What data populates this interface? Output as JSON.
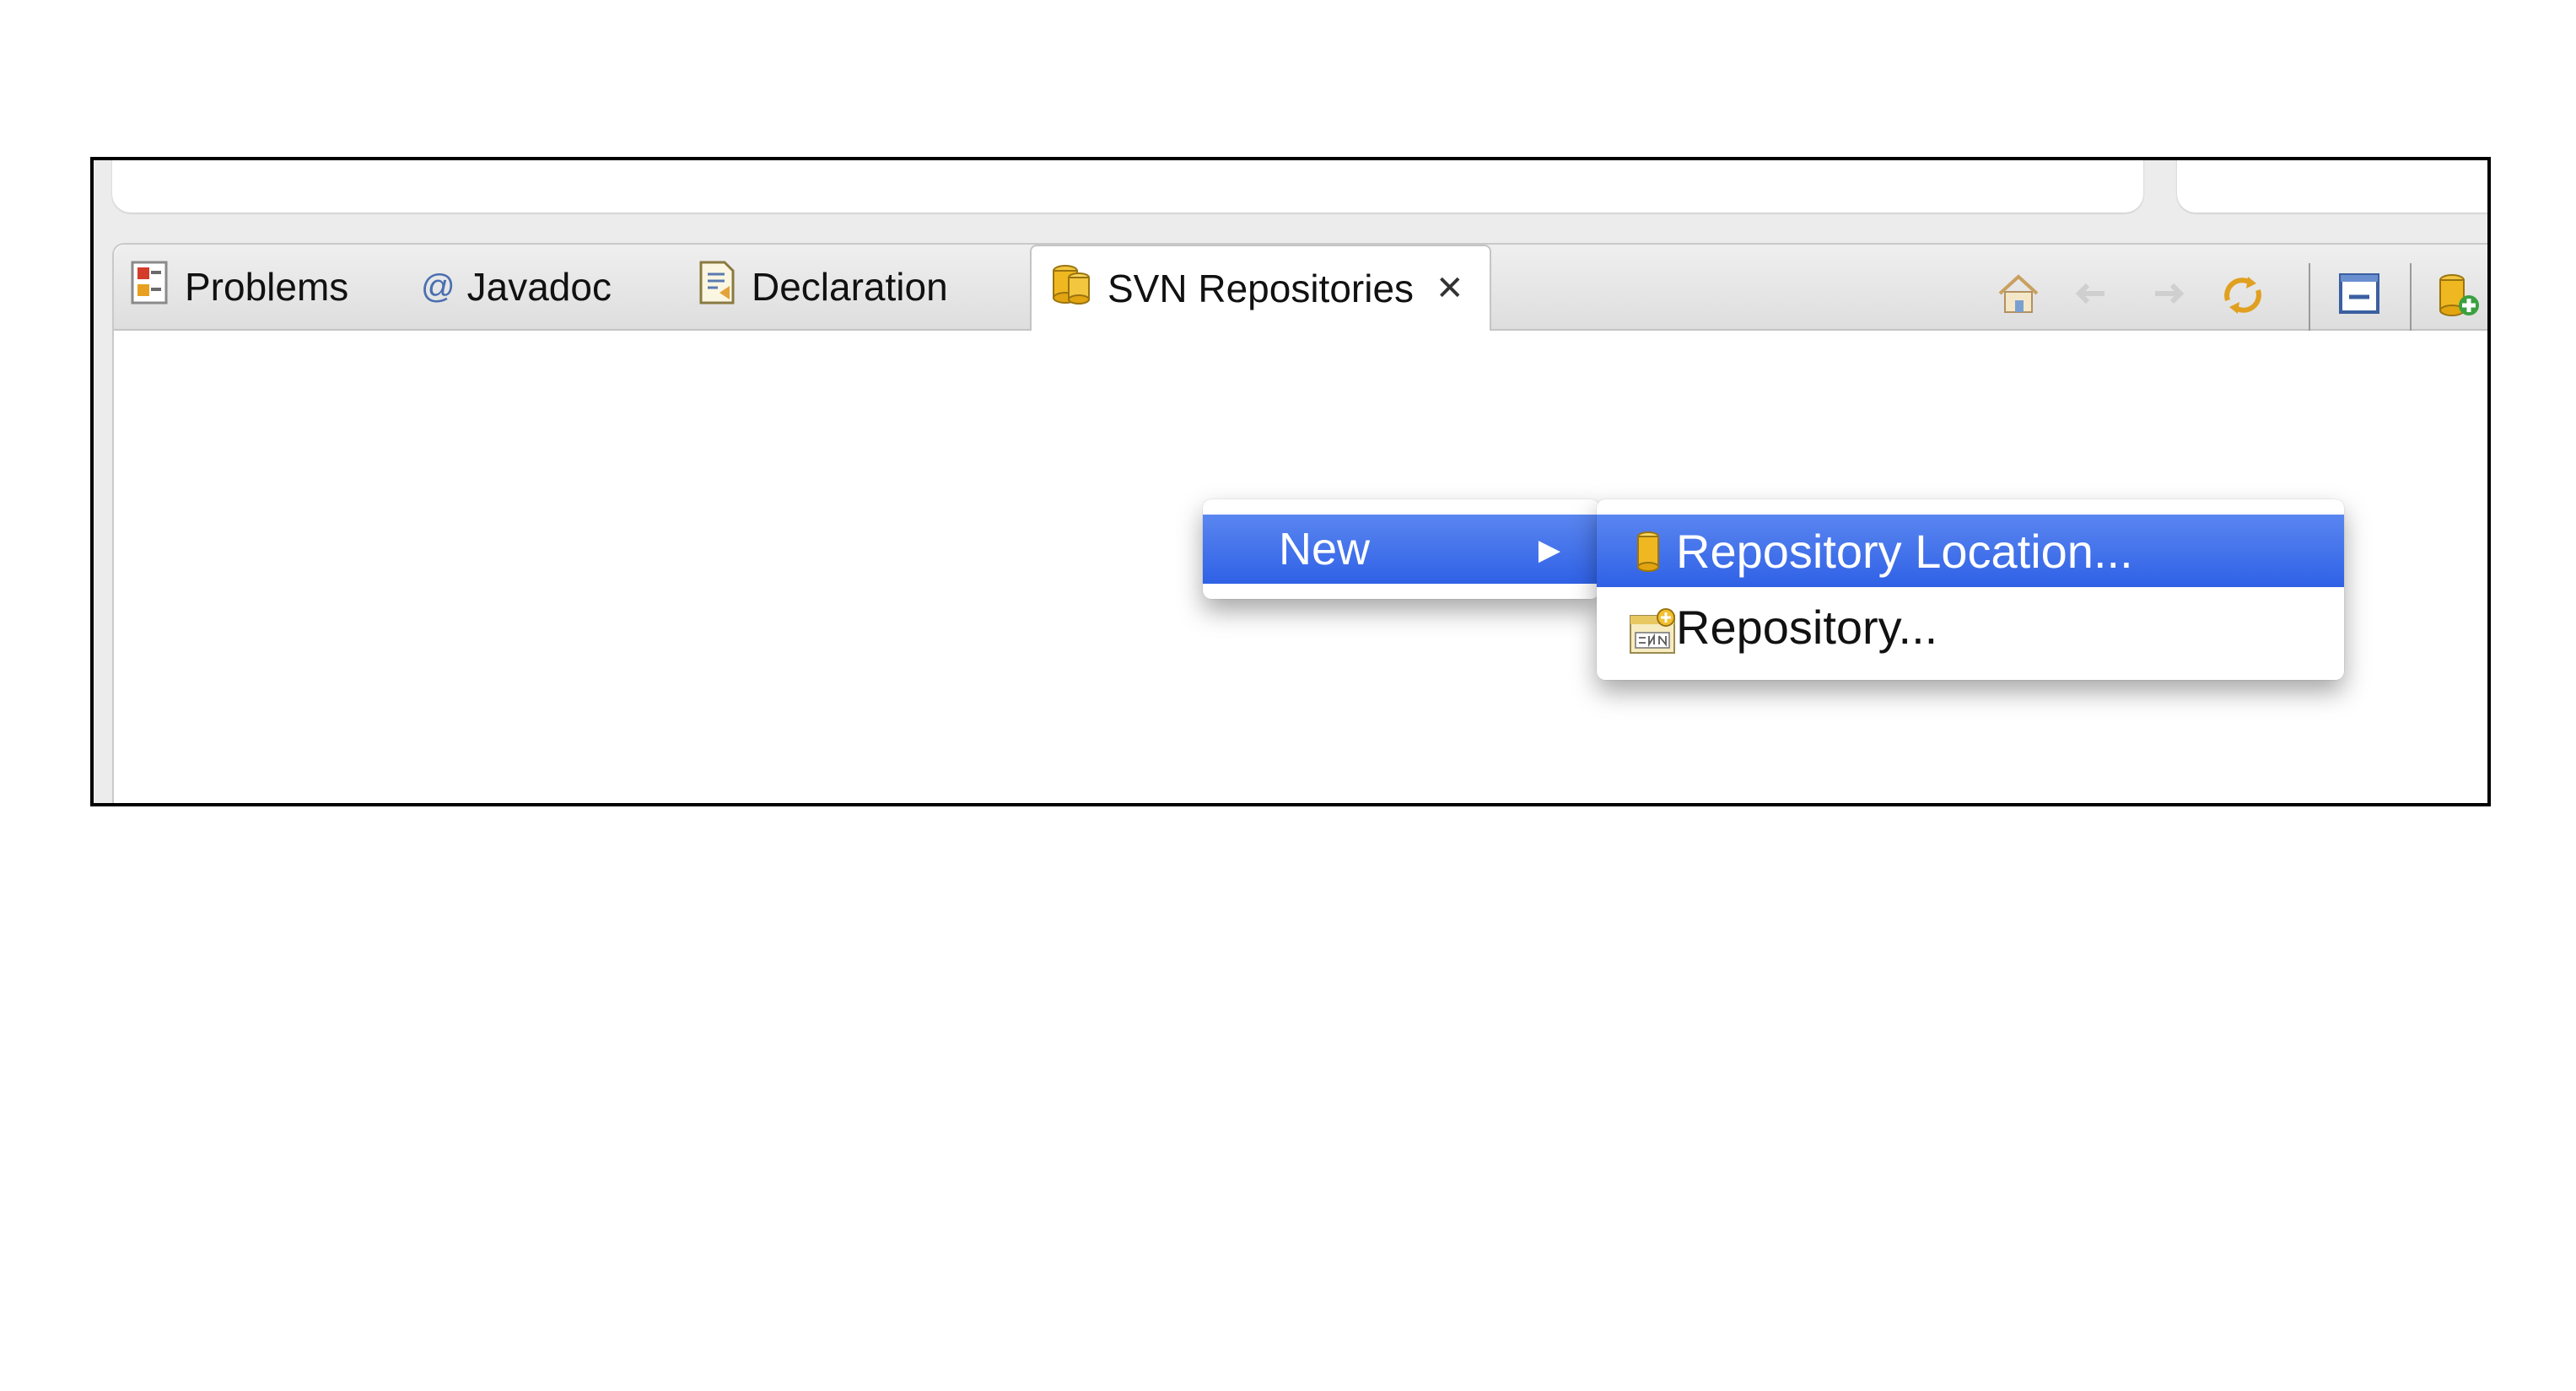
{
  "tabs": {
    "problems": "Problems",
    "javadoc_at": "@",
    "javadoc": "Javadoc",
    "declaration": "Declaration",
    "svn": "SVN Repositories",
    "close_glyph": "✕"
  },
  "toolbar_icons": [
    "home-icon",
    "back-arrow-icon",
    "forward-arrow-icon",
    "refresh-icon",
    "collapse-all-icon",
    "new-repository-location-icon"
  ],
  "context_menu": {
    "new_label": "New",
    "submenu_arrow": "▶"
  },
  "submenu": {
    "repository_location": "Repository Location...",
    "repository": "Repository..."
  },
  "colors": {
    "selection": "#3d6eea",
    "tab_bar": "#e6e6e6"
  }
}
